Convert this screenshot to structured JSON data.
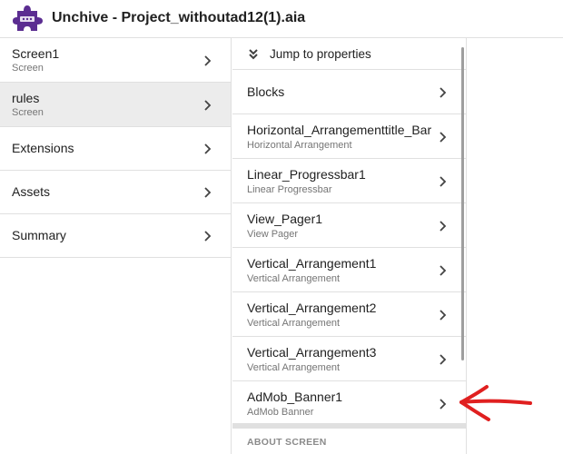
{
  "header": {
    "title": "Unchive - Project_withoutad12(1).aia",
    "logo_icon": "puzzle-piece-icon",
    "logo_color": "#5b2d91"
  },
  "sidebar": {
    "items": [
      {
        "label": "Screen1",
        "sub": "Screen",
        "selected": false
      },
      {
        "label": "rules",
        "sub": "Screen",
        "selected": true
      },
      {
        "label": "Extensions",
        "sub": "",
        "selected": false
      },
      {
        "label": "Assets",
        "sub": "",
        "selected": false
      },
      {
        "label": "Summary",
        "sub": "",
        "selected": false
      }
    ]
  },
  "components": {
    "jump_label": "Jump to properties",
    "jump_icon": "double-chevron-down-icon",
    "items": [
      {
        "label": "Blocks",
        "sub": ""
      },
      {
        "label": "Horizontal_Arrangementtitle_Bar",
        "sub": "Horizontal Arrangement"
      },
      {
        "label": "Linear_Progressbar1",
        "sub": "Linear Progressbar"
      },
      {
        "label": "View_Pager1",
        "sub": "View Pager"
      },
      {
        "label": "Vertical_Arrangement1",
        "sub": "Vertical Arrangement"
      },
      {
        "label": "Vertical_Arrangement2",
        "sub": "Vertical Arrangement"
      },
      {
        "label": "Vertical_Arrangement3",
        "sub": "Vertical Arrangement"
      },
      {
        "label": "AdMob_Banner1",
        "sub": "AdMob Banner"
      }
    ],
    "about_label": "ABOUT SCREEN"
  },
  "annotation": {
    "icon": "red-arrow-icon",
    "color": "#e02020"
  }
}
